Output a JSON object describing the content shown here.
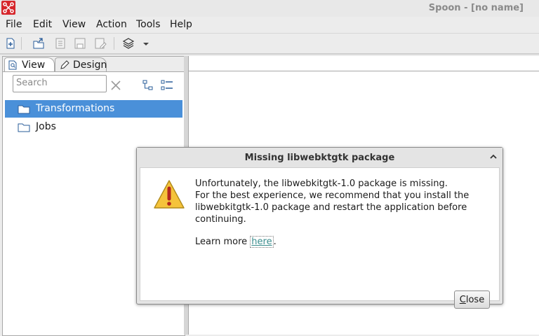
{
  "window": {
    "title": "Spoon - [no name]"
  },
  "menu": {
    "items": [
      "File",
      "Edit",
      "View",
      "Action",
      "Tools",
      "Help"
    ]
  },
  "left_panel": {
    "tabs": [
      {
        "label": "View"
      },
      {
        "label": "Design"
      }
    ],
    "search": {
      "placeholder": "Search"
    },
    "tree": [
      {
        "label": "Transformations",
        "selected": true
      },
      {
        "label": "Jobs",
        "selected": false
      }
    ]
  },
  "dialog": {
    "title": "Missing libwebktgtk package",
    "message_lines": [
      "Unfortunately, the libwebkitgtk-1.0 package is missing.",
      "For the best experience, we recommend that you install the",
      "libwebkitgtk-1.0 package and restart the application before",
      "continuing."
    ],
    "learn_more_prefix": "Learn more ",
    "learn_more_link": "here",
    "learn_more_suffix": ".",
    "close_label_first": "C",
    "close_label_rest": "lose"
  },
  "colors": {
    "selection": "#4a90d9",
    "app_logo": "#d6262b",
    "warning": "#f5c33b",
    "link": "#3a8d8d"
  },
  "icons": [
    "spoon-logo-icon",
    "new-file-icon",
    "open-file-icon",
    "explore-repository-icon",
    "save-icon",
    "save-as-icon",
    "perspective-layers-icon",
    "dropdown-arrow-icon",
    "view-tab-icon",
    "design-tab-icon",
    "clear-search-icon",
    "collapse-tree-icon",
    "expand-tree-icon",
    "folder-icon",
    "warning-icon",
    "collapse-dialog-icon"
  ]
}
